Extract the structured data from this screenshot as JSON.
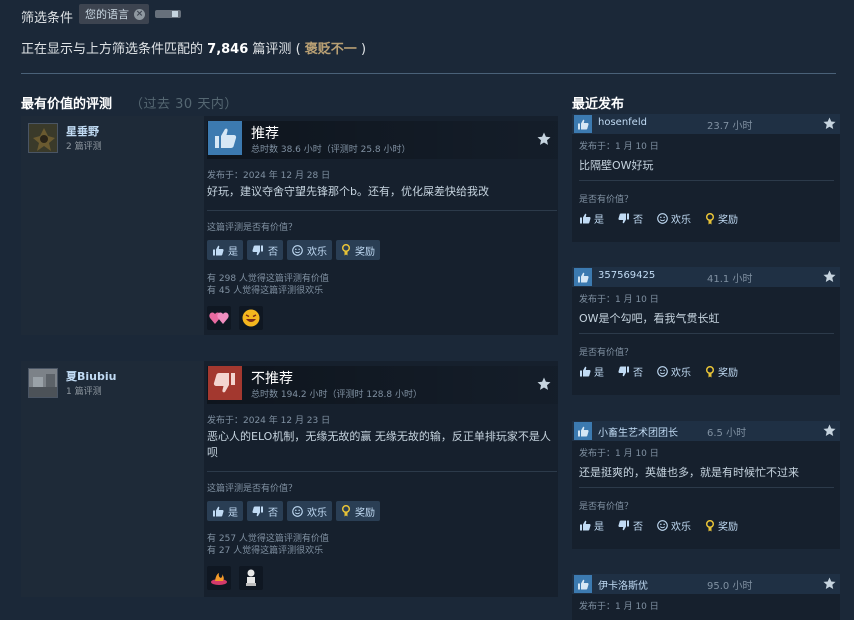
{
  "filter": {
    "label": "筛选条件",
    "chip_label": "您的语言",
    "chip_remove": "×"
  },
  "summary": {
    "prefix": "正在显示与上方筛选条件匹配的",
    "count": "7,846",
    "suffix": "篇评测",
    "paren_open": "(",
    "rating": "褒贬不一",
    "paren_close": ")"
  },
  "most_helpful": {
    "title": "最有价值的评测",
    "subtitle": "（过去 30 天内）"
  },
  "recent": {
    "title": "最近发布"
  },
  "labels": {
    "helpful_question": "这篇评测是否有价值？",
    "recent_question": "是否有价值？",
    "yes": "是",
    "no": "否",
    "funny": "欢乐",
    "award": "奖励"
  },
  "reviews": [
    {
      "author": "星垂野",
      "review_count": "2 篇评测",
      "verdict": "推荐",
      "hours": "总时数 38.6 小时（评测时 25.8 小时）",
      "posted": "发布于：2024 年 12 月 28 日",
      "text": "好玩，建议夺舍守望先锋那个b。还有，优化屎差快给我改",
      "helpful_tally": "有 298 人觉得这篇评测有价值",
      "funny_tally": "有 45 人觉得这篇评测很欢乐"
    },
    {
      "author": "夏Biubiu",
      "review_count": "1 篇评测",
      "verdict": "不推荐",
      "hours": "总时数 194.2 小时（评测时 128.8 小时）",
      "posted": "发布于：2024 年 12 月 23 日",
      "text": "恶心人的ELO机制，无缘无故的赢 无缘无故的输，反正单排玩家不是人呗",
      "helpful_tally": "有 257 人觉得这篇评测有价值",
      "funny_tally": "有 27 人觉得这篇评测很欢乐"
    }
  ],
  "recent_reviews": [
    {
      "name": "hosenfeld",
      "hours": "23.7 小时",
      "posted": "发布于：1 月 10 日",
      "text": "比隔壁OW好玩"
    },
    {
      "name": "357569425",
      "hours": "41.1 小时",
      "posted": "发布于：1 月 10 日",
      "text": "OW是个勾吧，看我气贯长虹"
    },
    {
      "name": "小畜生艺术团团长",
      "hours": "6.5 小时",
      "posted": "发布于：1 月 10 日",
      "text": "还是挺爽的，英雄也多，就是有时候忙不过来"
    },
    {
      "name": "伊卡洛斯优",
      "hours": "95.0 小时",
      "posted": "发布于：1 月 10 日"
    }
  ],
  "colors": {
    "background": "#1b2838",
    "recommend_blue": "#3c7ab0",
    "not_recommend_red": "#a3382f",
    "mixed_rating": "#b9a074"
  }
}
